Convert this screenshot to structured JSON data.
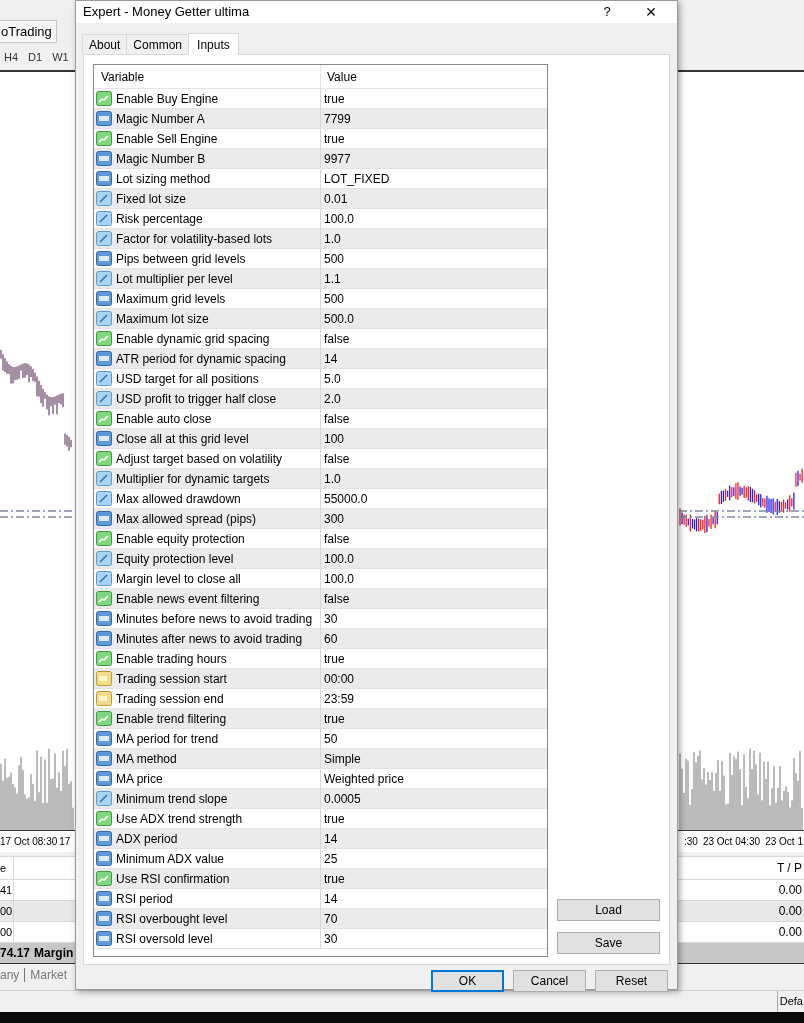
{
  "background": {
    "toolbar_button": "oTrading",
    "timeframes": [
      "H4",
      "D1",
      "W1"
    ],
    "time_axis_left": [
      "17 Oct 08:30",
      "17"
    ],
    "time_axis_right": [
      ":30",
      "23 Oct 04:30",
      "23 Oct 1"
    ],
    "terminal": {
      "left_header": "e",
      "right_header": "T / P",
      "left_cells": [
        "41",
        "00",
        "00"
      ],
      "right_cells": [
        "0.00",
        "0.00",
        "0.00"
      ],
      "summary": [
        "74.17",
        "Margin"
      ]
    },
    "bottom_tabs": [
      "any",
      "Market"
    ],
    "status_text": "Defa"
  },
  "dialog": {
    "title": "Expert - Money Getter ultima",
    "help": "?",
    "close": "×",
    "tabs": [
      {
        "label": "About",
        "selected": false
      },
      {
        "label": "Common",
        "selected": false
      },
      {
        "label": "Inputs",
        "selected": true
      }
    ],
    "columns": [
      "Variable",
      "Value"
    ],
    "inputs": [
      {
        "kind": "bool",
        "name": "Enable Buy Engine",
        "value": "true"
      },
      {
        "kind": "int",
        "name": "Magic Number A",
        "value": "7799"
      },
      {
        "kind": "bool",
        "name": "Enable Sell Engine",
        "value": "true"
      },
      {
        "kind": "int",
        "name": "Magic Number B",
        "value": "9977"
      },
      {
        "kind": "int",
        "name": "Lot sizing method",
        "value": "LOT_FIXED"
      },
      {
        "kind": "double",
        "name": "Fixed lot size",
        "value": "0.01"
      },
      {
        "kind": "double",
        "name": "Risk percentage",
        "value": "100.0"
      },
      {
        "kind": "double",
        "name": "Factor for volatility-based lots",
        "value": "1.0"
      },
      {
        "kind": "int",
        "name": "Pips between grid levels",
        "value": "500"
      },
      {
        "kind": "double",
        "name": "Lot multiplier per level",
        "value": "1.1"
      },
      {
        "kind": "int",
        "name": "Maximum grid levels",
        "value": "500"
      },
      {
        "kind": "double",
        "name": "Maximum lot size",
        "value": "500.0"
      },
      {
        "kind": "bool",
        "name": "Enable dynamic grid spacing",
        "value": "false"
      },
      {
        "kind": "int",
        "name": "ATR period for dynamic spacing",
        "value": "14"
      },
      {
        "kind": "double",
        "name": "USD target for all positions",
        "value": "5.0"
      },
      {
        "kind": "double",
        "name": "USD profit to trigger half close",
        "value": "2.0"
      },
      {
        "kind": "bool",
        "name": "Enable auto close",
        "value": "false"
      },
      {
        "kind": "int",
        "name": "Close all at this grid level",
        "value": "100"
      },
      {
        "kind": "bool",
        "name": "Adjust target based on volatility",
        "value": "false"
      },
      {
        "kind": "double",
        "name": "Multiplier for dynamic targets",
        "value": "1.0"
      },
      {
        "kind": "double",
        "name": "Max allowed drawdown",
        "value": "55000.0"
      },
      {
        "kind": "int",
        "name": "Max allowed spread (pips)",
        "value": "300"
      },
      {
        "kind": "bool",
        "name": "Enable equity protection",
        "value": "false"
      },
      {
        "kind": "double",
        "name": "Equity protection level",
        "value": "100.0"
      },
      {
        "kind": "double",
        "name": "Margin level to close all",
        "value": "100.0"
      },
      {
        "kind": "bool",
        "name": "Enable news event filtering",
        "value": "false"
      },
      {
        "kind": "int",
        "name": "Minutes before news to avoid trading",
        "value": "30"
      },
      {
        "kind": "int",
        "name": "Minutes after news to avoid trading",
        "value": "60"
      },
      {
        "kind": "bool",
        "name": "Enable trading hours",
        "value": "true"
      },
      {
        "kind": "string",
        "name": "Trading session start",
        "value": "00:00"
      },
      {
        "kind": "string",
        "name": "Trading session end",
        "value": "23:59"
      },
      {
        "kind": "bool",
        "name": "Enable trend filtering",
        "value": "true"
      },
      {
        "kind": "int",
        "name": "MA period for trend",
        "value": "50"
      },
      {
        "kind": "int",
        "name": "MA method",
        "value": "Simple"
      },
      {
        "kind": "int",
        "name": "MA price",
        "value": "Weighted price"
      },
      {
        "kind": "double",
        "name": "Minimum trend slope",
        "value": "0.0005"
      },
      {
        "kind": "bool",
        "name": "Use ADX trend strength",
        "value": "true"
      },
      {
        "kind": "int",
        "name": "ADX period",
        "value": "14"
      },
      {
        "kind": "int",
        "name": "Minimum ADX value",
        "value": "25"
      },
      {
        "kind": "bool",
        "name": "Use RSI confirmation",
        "value": "true"
      },
      {
        "kind": "int",
        "name": "RSI period",
        "value": "14"
      },
      {
        "kind": "int",
        "name": "RSI overbought level",
        "value": "70"
      },
      {
        "kind": "int",
        "name": "RSI oversold level",
        "value": "30"
      }
    ],
    "side_buttons": [
      "Load",
      "Save"
    ],
    "buttons": [
      {
        "label": "OK",
        "default": true
      },
      {
        "label": "Cancel",
        "default": false
      },
      {
        "label": "Reset",
        "default": false
      }
    ]
  }
}
